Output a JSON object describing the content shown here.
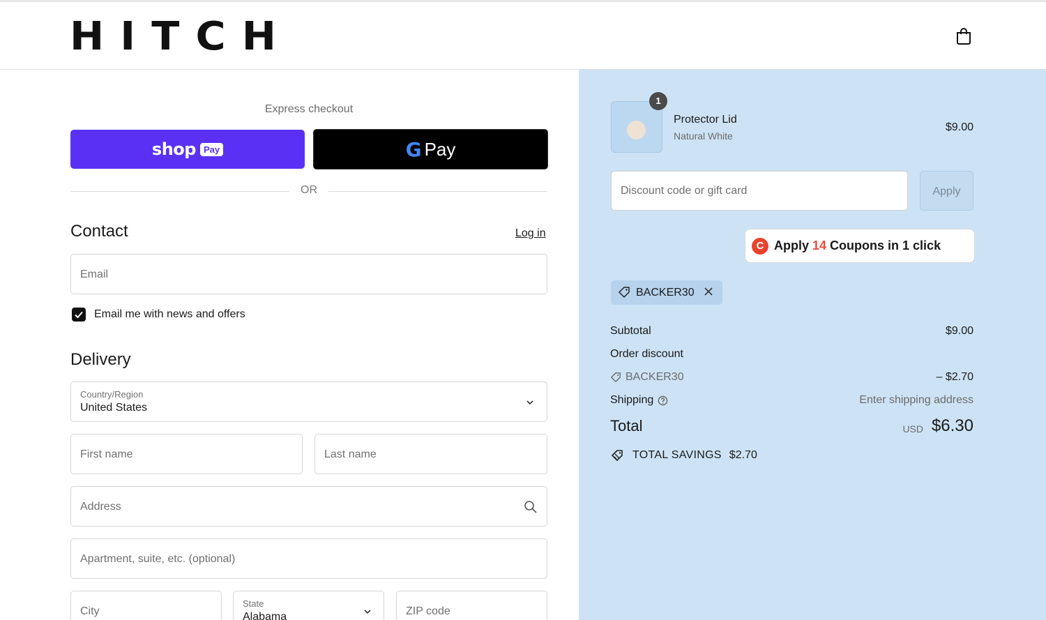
{
  "header": {
    "logo": "HITCH",
    "cart_icon": "shopping-bag-icon"
  },
  "express": {
    "label": "Express checkout",
    "shop_pay_word": "shop",
    "shop_pay_badge": "Pay",
    "gpay_g": "G",
    "gpay_word": "Pay",
    "or_text": "OR"
  },
  "contact": {
    "heading": "Contact",
    "login_link": "Log in",
    "email_placeholder": "Email",
    "newsletter_label": "Email me with news and offers",
    "newsletter_checked": true
  },
  "delivery": {
    "heading": "Delivery",
    "country_label": "Country/Region",
    "country_value": "United States",
    "first_name_placeholder": "First name",
    "last_name_placeholder": "Last name",
    "address_placeholder": "Address",
    "apartment_placeholder": "Apartment, suite, etc. (optional)",
    "city_placeholder": "City",
    "state_label": "State",
    "state_value": "Alabama",
    "zip_placeholder": "ZIP code"
  },
  "order": {
    "item": {
      "quantity": "1",
      "name": "Protector Lid",
      "variant": "Natural White",
      "price": "$9.00"
    },
    "discount_placeholder": "Discount code or gift card",
    "apply_label": "Apply",
    "coupon_button": {
      "prefix": "Apply ",
      "count": "14",
      "suffix": " Coupons in 1 click",
      "logo_letter": "C"
    },
    "applied_code": "BACKER30",
    "subtotal_label": "Subtotal",
    "subtotal_value": "$9.00",
    "order_discount_label": "Order discount",
    "discount_code": "BACKER30",
    "discount_value": "– $2.70",
    "shipping_label": "Shipping",
    "shipping_value": "Enter shipping address",
    "total_label": "Total",
    "total_currency": "USD",
    "total_value": "$6.30",
    "savings_label": "TOTAL SAVINGS",
    "savings_value": "$2.70"
  },
  "colors": {
    "shop_pay": "#5a31f4",
    "summary_bg": "#cde3f5",
    "coupon_accent": "#ef4a3a"
  }
}
